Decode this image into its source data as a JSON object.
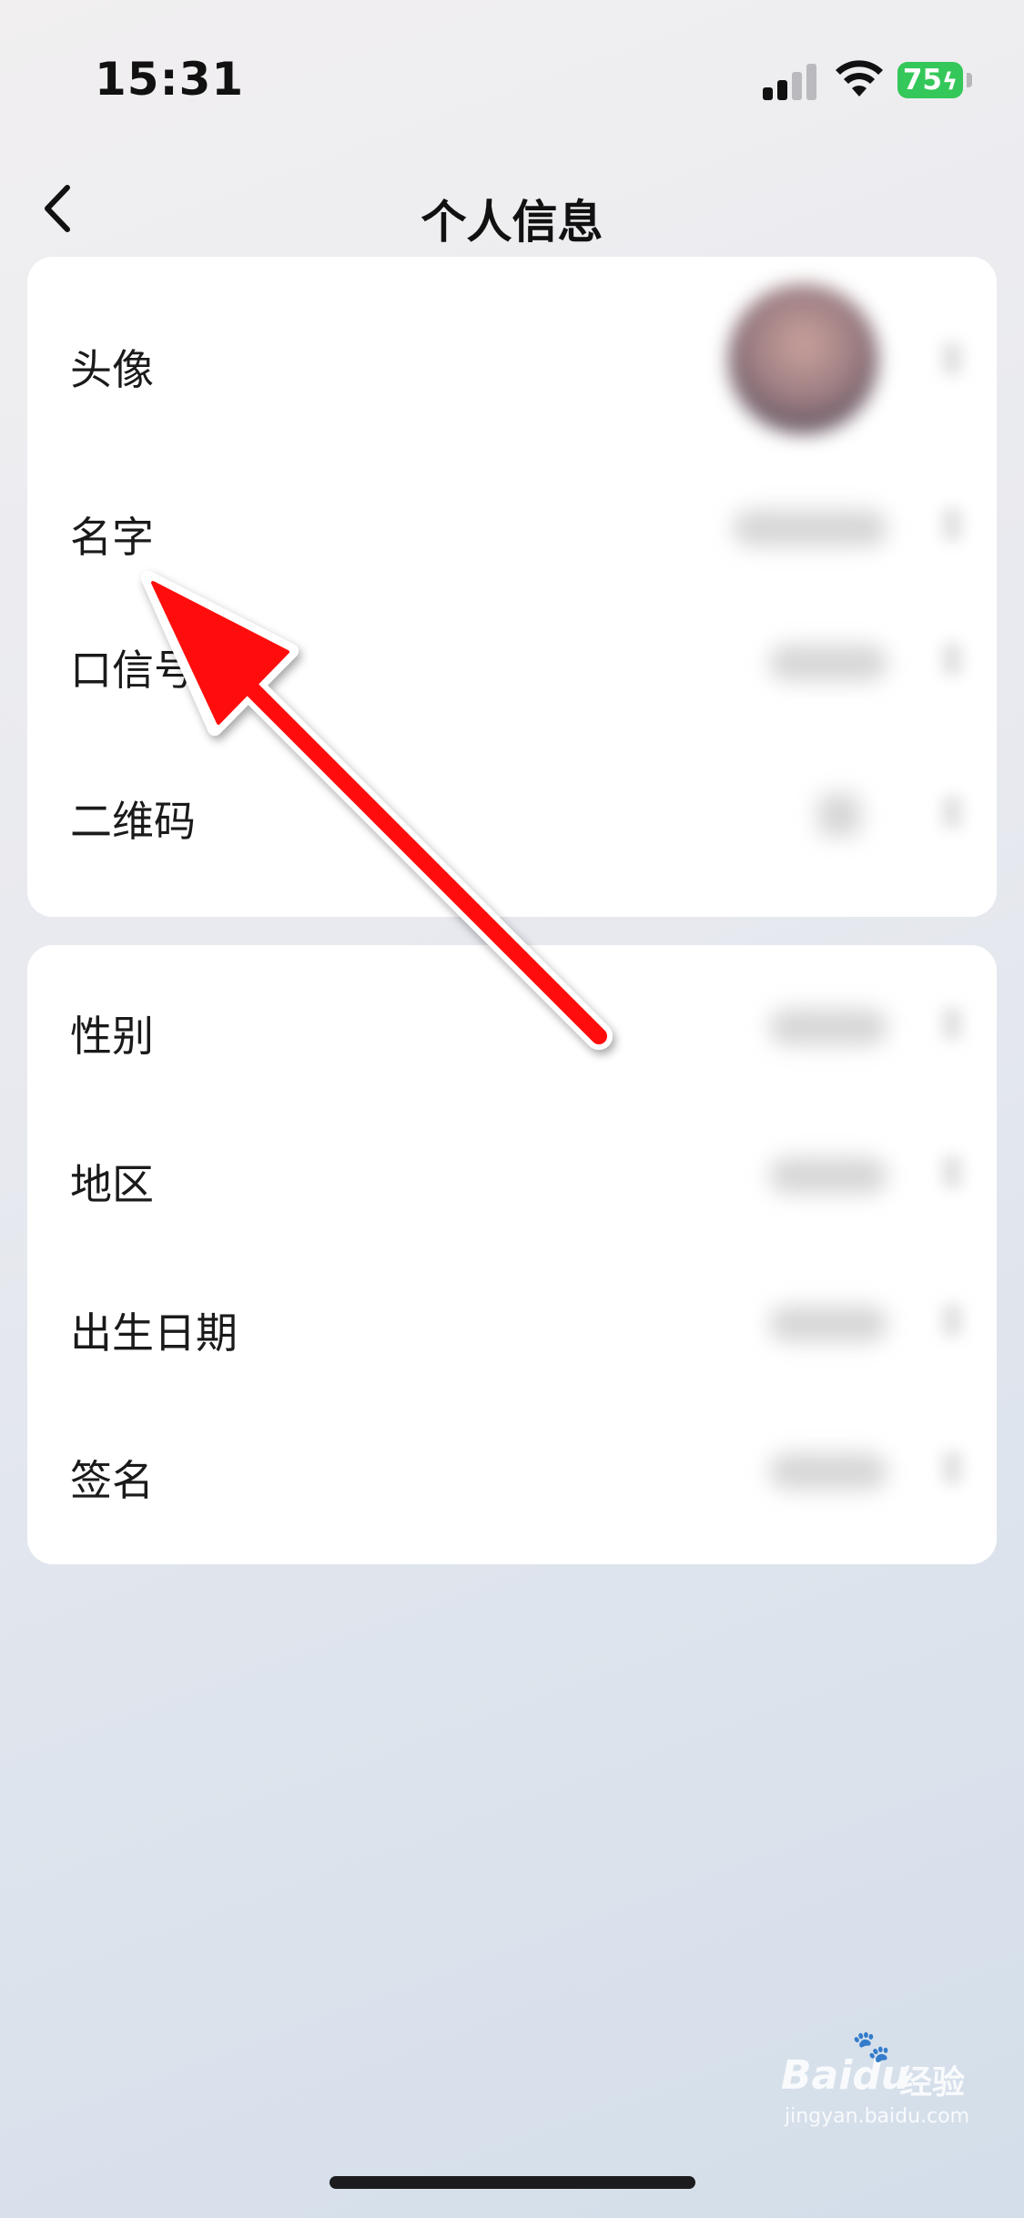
{
  "status_bar": {
    "time": "15:31",
    "battery_level": "75",
    "signal_bars_active": 2,
    "signal_bars_total": 4,
    "icons": [
      "cellular-signal-icon",
      "wifi-icon",
      "battery-charging-icon"
    ],
    "battery_color": "#34c759"
  },
  "nav": {
    "title": "个人信息",
    "back_icon": "chevron-left-icon"
  },
  "group_one": [
    {
      "label": "头像",
      "value_kind": "avatar-image-blurred"
    },
    {
      "label": "名字",
      "value_kind": "text-blurred"
    },
    {
      "label": "口信号",
      "value_kind": "text-blurred"
    },
    {
      "label": "二维码",
      "value_kind": "icon-blurred"
    }
  ],
  "group_two": [
    {
      "label": "性别",
      "value_kind": "text-blurred"
    },
    {
      "label": "地区",
      "value_kind": "text-blurred"
    },
    {
      "label": "出生日期",
      "value_kind": "text-blurred"
    },
    {
      "label": "签名",
      "value_kind": "text-blurred"
    }
  ],
  "annotation": {
    "type": "arrow",
    "color": "#ff0000",
    "points_to": "名字"
  },
  "watermark": {
    "brand": "Bai",
    "brand_suffix": "du",
    "product": "经验",
    "url": "jingyan.baidu.com"
  }
}
